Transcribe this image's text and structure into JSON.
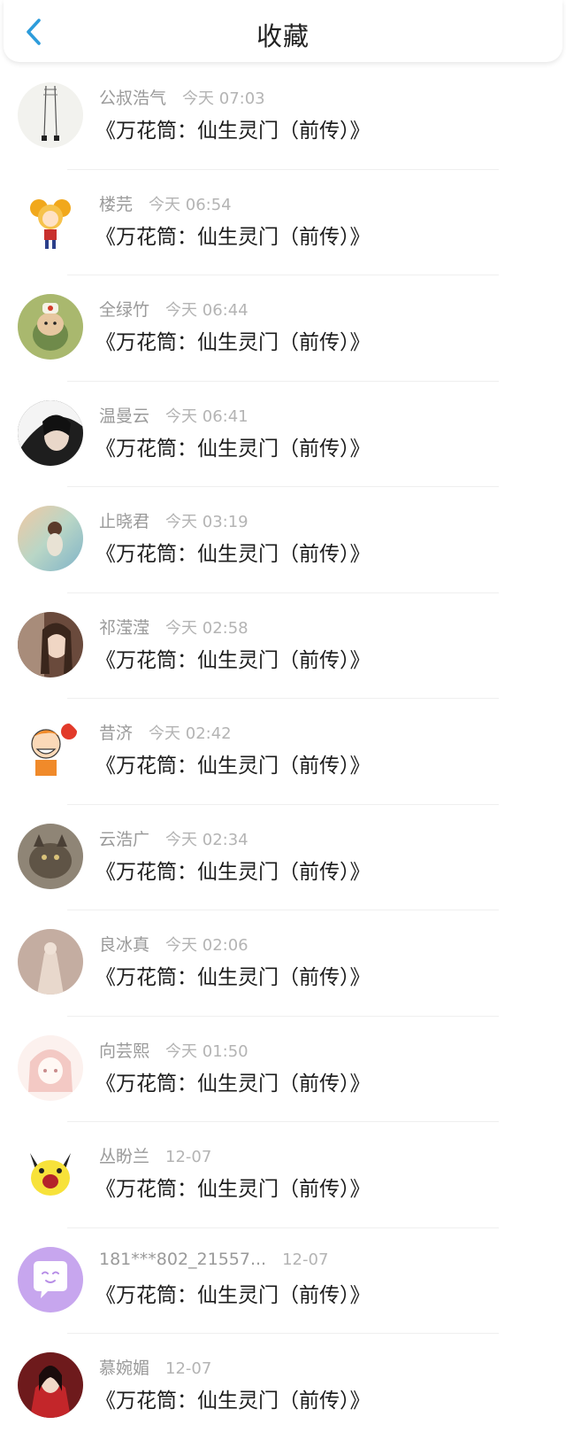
{
  "header": {
    "title": "收藏",
    "back_icon": "chevron-left-icon",
    "accent_color": "#2d9cdb"
  },
  "items": [
    {
      "user": "公叔浩气",
      "time": "今天 07:03",
      "title": "《万花筒：仙生灵门（前传）》",
      "avatar_color": "#f3f3ef"
    },
    {
      "user": "楼芫",
      "time": "今天 06:54",
      "title": "《万花筒：仙生灵门（前传）》",
      "avatar_color": "#ffffff"
    },
    {
      "user": "全绿竹",
      "time": "今天 06:44",
      "title": "《万花筒：仙生灵门（前传）》",
      "avatar_color": "#a7b56c"
    },
    {
      "user": "温曼云",
      "time": "今天 06:41",
      "title": "《万花筒：仙生灵门（前传）》",
      "avatar_color": "#3a3a3a"
    },
    {
      "user": "止晓君",
      "time": "今天 03:19",
      "title": "《万花筒：仙生灵门（前传）》",
      "avatar_color": "#9bc4b8"
    },
    {
      "user": "祁滢滢",
      "time": "今天 02:58",
      "title": "《万花筒：仙生灵门（前传）》",
      "avatar_color": "#6b4a3d"
    },
    {
      "user": "昔济",
      "time": "今天 02:42",
      "title": "《万花筒：仙生灵门（前传）》",
      "avatar_color": "#ffffff"
    },
    {
      "user": "云浩广",
      "time": "今天 02:34",
      "title": "《万花筒：仙生灵门（前传）》",
      "avatar_color": "#6e6456"
    },
    {
      "user": "良冰真",
      "time": "今天 02:06",
      "title": "《万花筒：仙生灵门（前传）》",
      "avatar_color": "#c9b2a6"
    },
    {
      "user": "向芸熙",
      "time": "今天 01:50",
      "title": "《万花筒：仙生灵门（前传）》",
      "avatar_color": "#fbefec"
    },
    {
      "user": "丛盼兰",
      "time": "12-07",
      "title": "《万花筒：仙生灵门（前传）》",
      "avatar_color": "#ffffff"
    },
    {
      "user": "181***802_21557...",
      "time": "12-07",
      "title": "《万花筒：仙生灵门（前传）》",
      "avatar_color": "#c9a8ef"
    },
    {
      "user": "慕婉媚",
      "time": "12-07",
      "title": "《万花筒：仙生灵门（前传）》",
      "avatar_color": "#7a1f1f"
    }
  ]
}
